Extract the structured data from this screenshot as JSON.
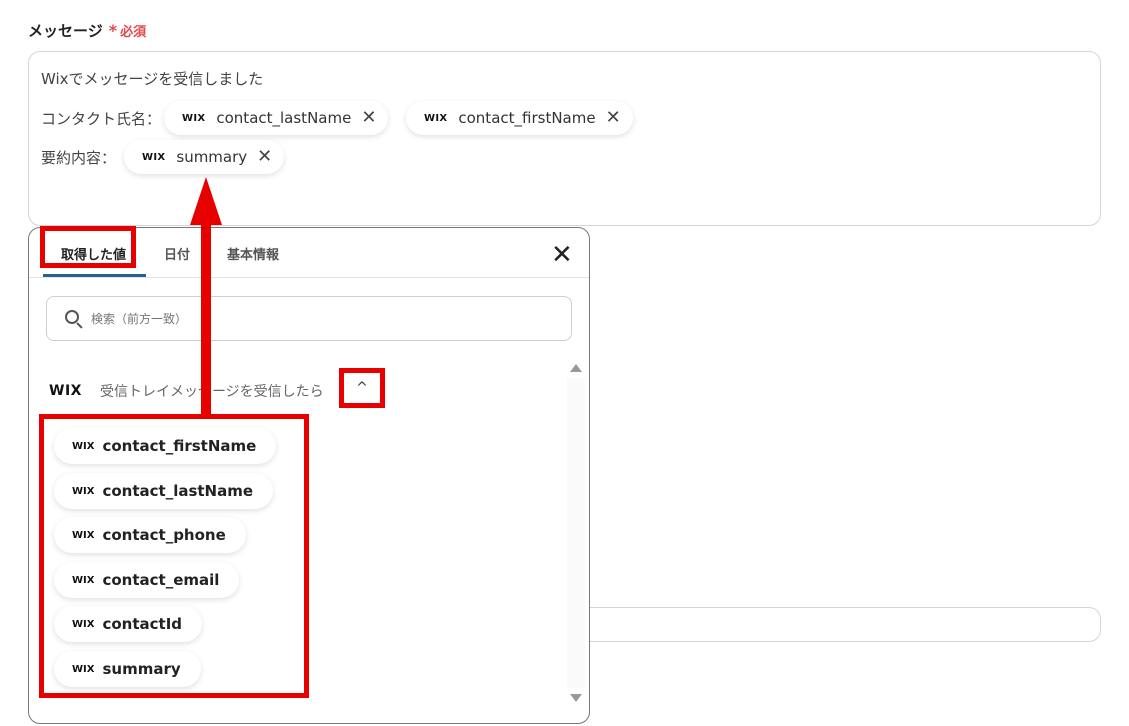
{
  "field": {
    "label": "メッセージ",
    "required_star": "*",
    "required_text": "必須"
  },
  "message": {
    "line1": "Wixでメッセージを受信しました",
    "line2_label": "コンタクト氏名：",
    "line3_label": "要約内容：",
    "chips": [
      {
        "logo": "WIX",
        "label": "contact_lastName",
        "close": "✕"
      },
      {
        "logo": "WIX",
        "label": "contact_firstName",
        "close": "✕"
      },
      {
        "logo": "WIX",
        "label": "summary",
        "close": "✕"
      }
    ]
  },
  "popup": {
    "tabs": [
      {
        "label": "取得した値"
      },
      {
        "label": "日付"
      },
      {
        "label": "基本情報"
      }
    ],
    "close": "✕",
    "search_placeholder": "検索（前方一致）",
    "group": {
      "logo": "WIX",
      "title": "受信トレイメッセージを受信したら",
      "toggle": "^"
    },
    "items": [
      {
        "logo": "WIX",
        "label": "contact_firstName"
      },
      {
        "logo": "WIX",
        "label": "contact_lastName"
      },
      {
        "logo": "WIX",
        "label": "contact_phone"
      },
      {
        "logo": "WIX",
        "label": "contact_email"
      },
      {
        "logo": "WIX",
        "label": "contactId"
      },
      {
        "logo": "WIX",
        "label": "summary"
      }
    ]
  },
  "colors": {
    "highlight": "#e60000",
    "tab_underline": "#2d5f8b",
    "required": "#e5484d"
  },
  "icons": [
    "close-icon",
    "search-icon",
    "chevron-up-icon",
    "scroll-up-icon",
    "scroll-down-icon",
    "arrow-up-annotation"
  ]
}
